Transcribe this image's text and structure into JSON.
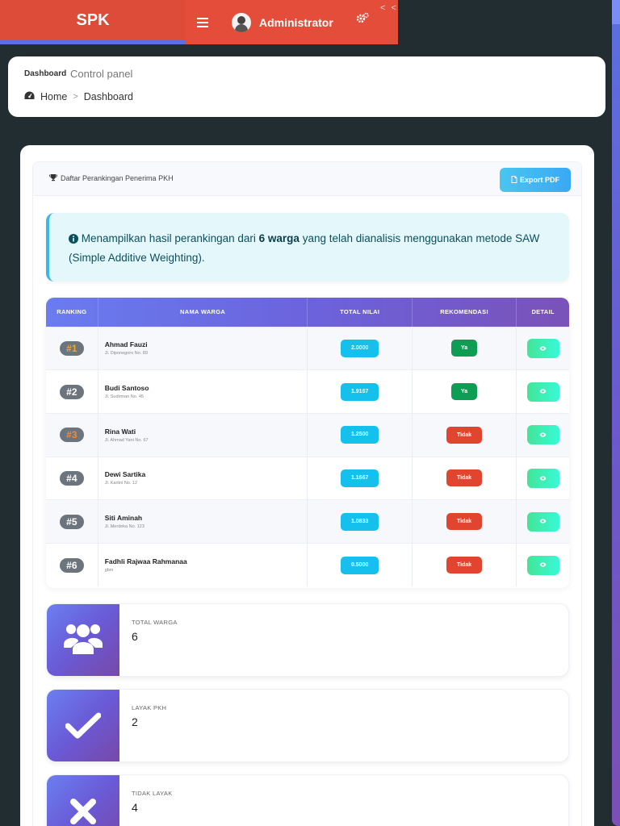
{
  "navbar": {
    "logo": "SPK",
    "hamburger_icon": "bars-icon",
    "user_name": "Administrator",
    "settings_icon": "gears-icon",
    "collapse_text": "< <"
  },
  "header": {
    "title": "Dashboard",
    "subtitle": "Control panel",
    "breadcrumb": [
      "Home",
      "Dashboard"
    ],
    "breadcrumb_separator": ">"
  },
  "ranking_panel": {
    "title": "Daftar Perankingan Penerima PKH",
    "export_label": "Export PDF",
    "info": {
      "prefix": "Menampilkan hasil perankingan dari ",
      "count_bold": "6 warga",
      "suffix": " yang telah dianalisis menggunakan metode SAW (Simple Additive Weighting)."
    },
    "columns": [
      "RANKING",
      "NAMA WARGA",
      "TOTAL NILAI",
      "REKOMENDASI",
      "DETAIL"
    ],
    "rows": [
      {
        "rank": "#1",
        "name": "Ahmad Fauzi",
        "address": "Jl. Diponegoro No. 89",
        "score": "2.0000",
        "rec": "Ya"
      },
      {
        "rank": "#2",
        "name": "Budi Santoso",
        "address": "Jl. Sudirman No. 45",
        "score": "1.9167",
        "rec": "Ya"
      },
      {
        "rank": "#3",
        "name": "Rina Wati",
        "address": "Jl. Ahmad Yani No. 67",
        "score": "1.2500",
        "rec": "Tidak"
      },
      {
        "rank": "#4",
        "name": "Dewi Sartika",
        "address": "Jl. Kartini No. 12",
        "score": "1.1667",
        "rec": "Tidak"
      },
      {
        "rank": "#5",
        "name": "Siti Aminah",
        "address": "Jl. Merdeka No. 123",
        "score": "1.0833",
        "rec": "Tidak"
      },
      {
        "rank": "#6",
        "name": "Fadhli Rajwaa Rahmanaa",
        "address": "gbm",
        "score": "0.5000",
        "rec": "Tidak"
      }
    ]
  },
  "stats": [
    {
      "label": "TOTAL WARGA",
      "value": "6",
      "icon": "users-icon"
    },
    {
      "label": "LAYAK PKH",
      "value": "2",
      "icon": "check-icon"
    },
    {
      "label": "TIDAK LAYAK",
      "value": "4",
      "icon": "times-icon"
    }
  ],
  "colors": {
    "brand_red": "#dd4b39",
    "accent_purple": "#6a5ad6",
    "score_blue": "#16c0ec",
    "yes_green": "#0e9d55",
    "no_red": "#e2452f",
    "detail_green": "#43e597"
  }
}
